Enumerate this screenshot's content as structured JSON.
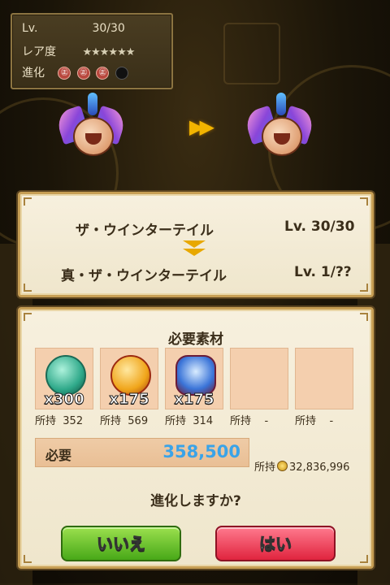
{
  "status": {
    "lv_label": "Lv.",
    "lv_value": "30/30",
    "rarity_label": "レア度",
    "rarity_stars": "★★★★★★",
    "evolution_label": "進化",
    "evolution_marks": [
      "㊣",
      "㊣",
      "㊣"
    ]
  },
  "evolve_arrow": "▶▶",
  "evolution": {
    "from_name": "ザ・ウインターテイル",
    "from_level": "Lv. 30/30",
    "to_name": "真・ザ・ウインターテイル",
    "to_level": "Lv. 1/??"
  },
  "materials": {
    "title": "必要素材",
    "items": [
      {
        "count": "x300",
        "owned_label": "所持",
        "owned": "352",
        "color": "#2fa98a"
      },
      {
        "count": "x175",
        "owned_label": "所持",
        "owned": "569",
        "color": "#f0a51a"
      },
      {
        "count": "x175",
        "owned_label": "所持",
        "owned": "314",
        "color": "#3a74d8"
      },
      {
        "count": "",
        "owned_label": "所持",
        "owned": "-"
      },
      {
        "count": "",
        "owned_label": "所持",
        "owned": "-"
      }
    ]
  },
  "cost": {
    "label": "必要",
    "value": "358,500",
    "owned_label": "所持",
    "owned_value": "32,836,996"
  },
  "confirm": {
    "question": "進化しますか?",
    "no_label": "いいえ",
    "yes_label": "はい"
  }
}
